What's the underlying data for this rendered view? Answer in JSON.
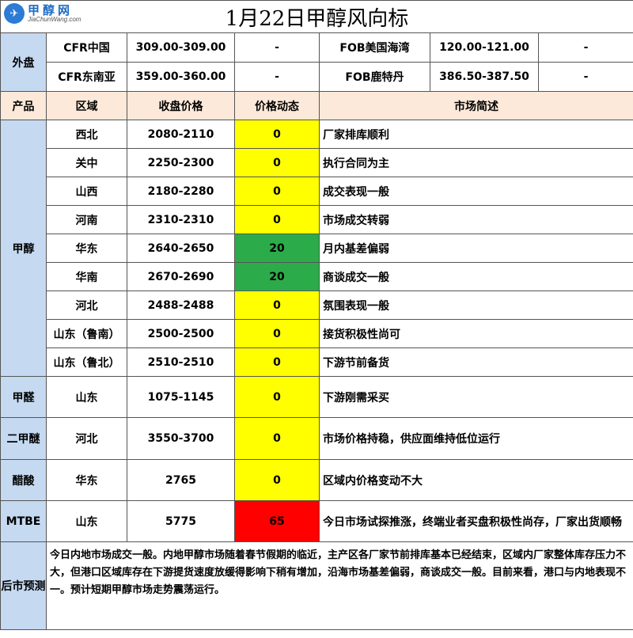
{
  "title": "1月22日甲醇风向标",
  "logo": {
    "cn": "甲醇网",
    "en": "JiaChunWang.com"
  },
  "external": {
    "label": "外盘",
    "rows": [
      {
        "n1": "CFR中国",
        "v1": "309.00-309.00",
        "c1": "-",
        "n2": "FOB美国海湾",
        "v2": "120.00-121.00",
        "c2": "-"
      },
      {
        "n1": "CFR东南亚",
        "v1": "359.00-360.00",
        "c1": "-",
        "n2": "FOB鹿特丹",
        "v2": "386.50-387.50",
        "c2": "-"
      }
    ]
  },
  "headers": {
    "product": "产品",
    "region": "区域",
    "price": "收盘价格",
    "change": "价格动态",
    "desc": "市场简述"
  },
  "methanol": {
    "label": "甲醇",
    "rows": [
      {
        "region": "西北",
        "price": "2080-2110",
        "change": "0",
        "desc": "厂家排库顺利"
      },
      {
        "region": "关中",
        "price": "2250-2300",
        "change": "0",
        "desc": "执行合同为主"
      },
      {
        "region": "山西",
        "price": "2180-2280",
        "change": "0",
        "desc": "成交表现一般"
      },
      {
        "region": "河南",
        "price": "2310-2310",
        "change": "0",
        "desc": "市场成交转弱"
      },
      {
        "region": "华东",
        "price": "2640-2650",
        "change": "20",
        "desc": "月内基差偏弱"
      },
      {
        "region": "华南",
        "price": "2670-2690",
        "change": "20",
        "desc": "商谈成交一般"
      },
      {
        "region": "河北",
        "price": "2488-2488",
        "change": "0",
        "desc": "氛围表现一般"
      },
      {
        "region": "山东（鲁南）",
        "price": "2500-2500",
        "change": "0",
        "desc": "接货积极性尚可"
      },
      {
        "region": "山东（鲁北）",
        "price": "2510-2510",
        "change": "0",
        "desc": "下游节前备货"
      }
    ]
  },
  "others": [
    {
      "product": "甲醛",
      "region": "山东",
      "price": "1075-1145",
      "change": "0",
      "desc": "下游刚需采买"
    },
    {
      "product": "二甲醚",
      "region": "河北",
      "price": "3550-3700",
      "change": "0",
      "desc": "市场价格持稳，供应面维持低位运行"
    },
    {
      "product": "醋酸",
      "region": "华东",
      "price": "2765",
      "change": "0",
      "desc": "区域内价格变动不大"
    },
    {
      "product": "MTBE",
      "region": "山东",
      "price": "5775",
      "change": "65",
      "desc": "今日市场试探推涨，终端业者买盘积极性尚存，厂家出货顺畅"
    }
  ],
  "forecast": {
    "label": "后市预测",
    "text": "今日内地市场成交一般。内地甲醇市场随着春节假期的临近，主产区各厂家节前排库基本已经结束，区域内厂家整体库存压力不大，但港口区域库存在下游提货速度放缓得影响下稍有增加，沿海市场基差偏弱，商谈成交一般。目前来看，港口与内地表现不一。预计短期甲醇市场走势震荡运行。"
  },
  "colors": {
    "side": "#c5d9f1",
    "header": "#fde9d9",
    "flat": "#ffff00",
    "up": "#2cab4a",
    "strong_up": "#ff0000"
  }
}
